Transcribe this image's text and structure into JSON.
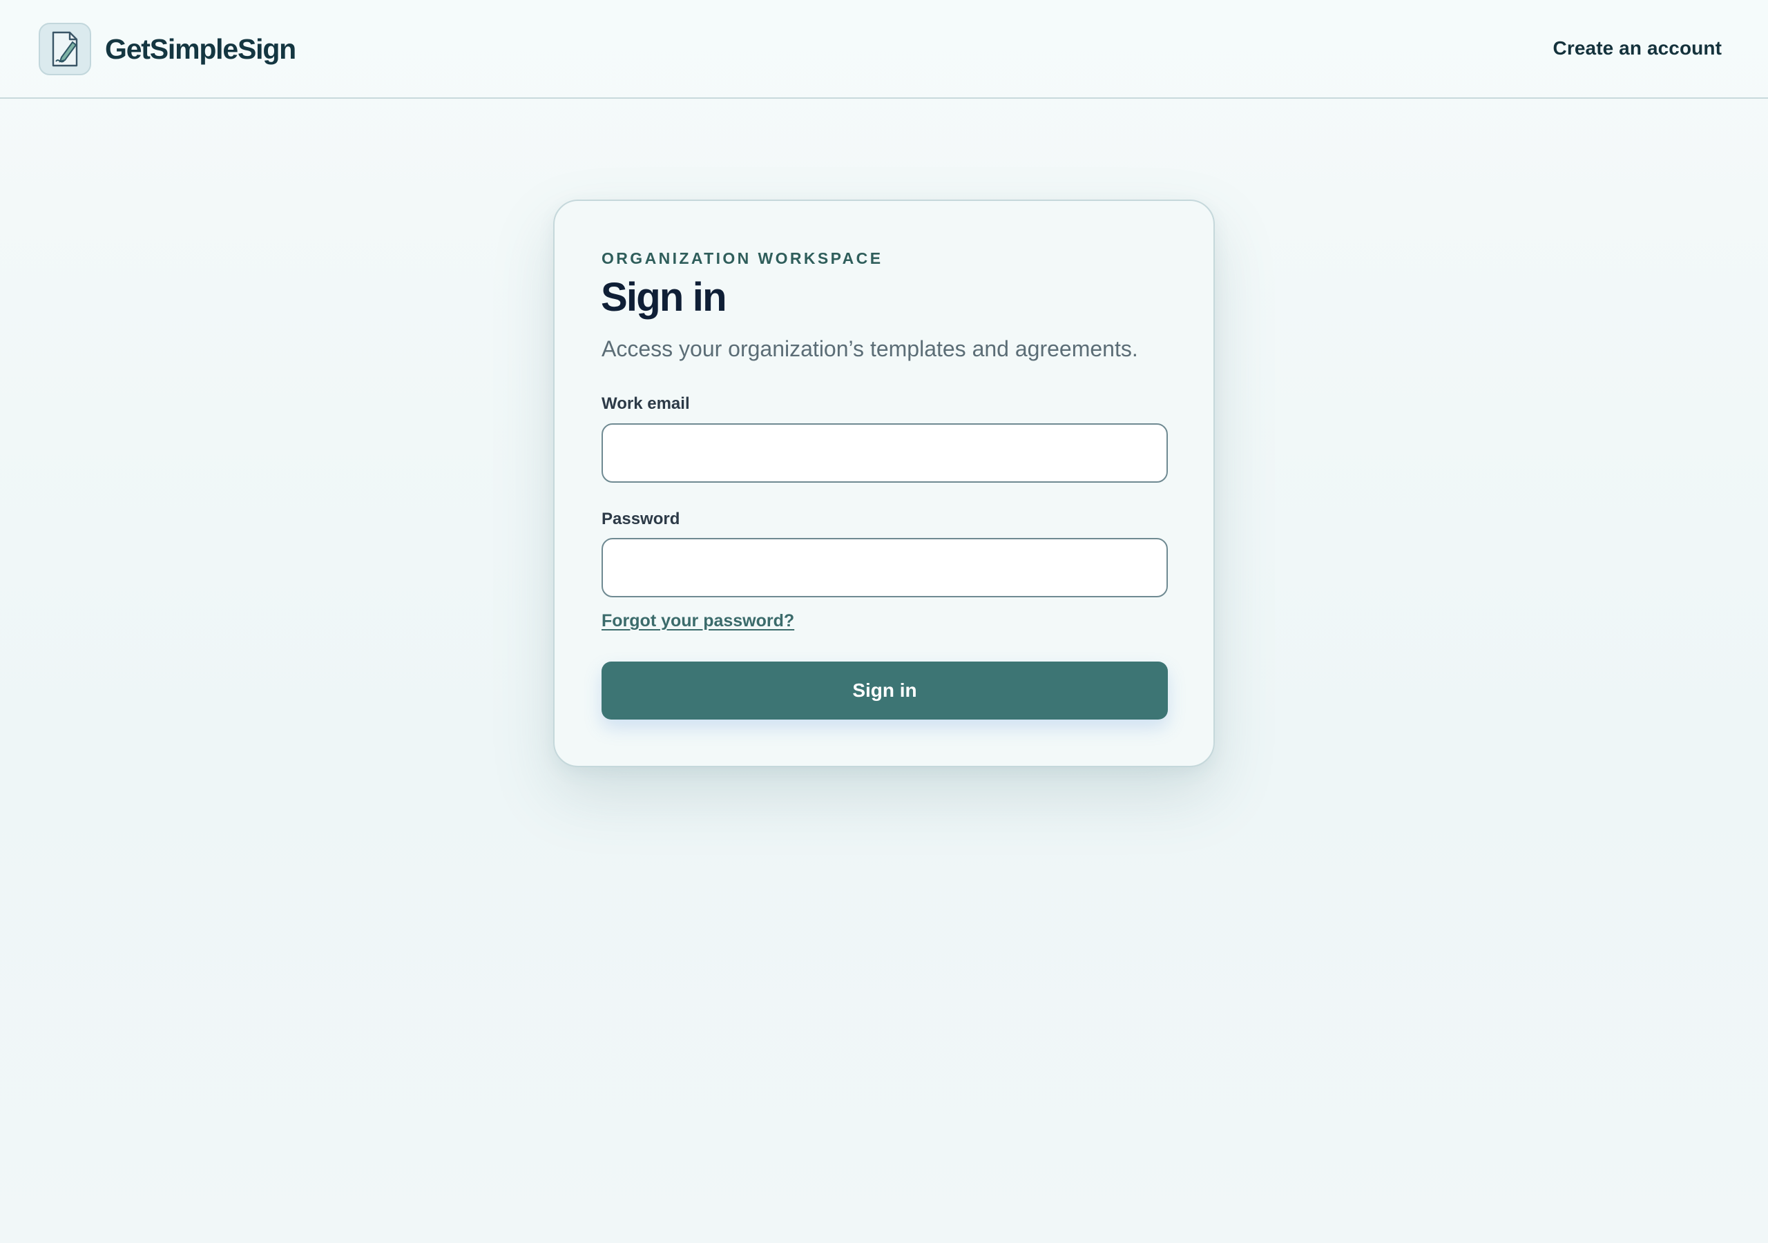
{
  "header": {
    "brand_name": "GetSimpleSign",
    "logo_icon": "document-pen-icon",
    "create_account_label": "Create an account"
  },
  "signin": {
    "eyebrow": "ORGANIZATION WORKSPACE",
    "title": "Sign in",
    "subtitle": "Access your organization’s templates and agreements.",
    "email_label": "Work email",
    "email_value": "",
    "password_label": "Password",
    "password_value": "",
    "forgot_label": "Forgot your password?",
    "submit_label": "Sign in"
  },
  "colors": {
    "accent": "#3d7574",
    "brand_text": "#143641",
    "heading": "#0f1f36",
    "eyebrow": "#2f5e5b"
  }
}
